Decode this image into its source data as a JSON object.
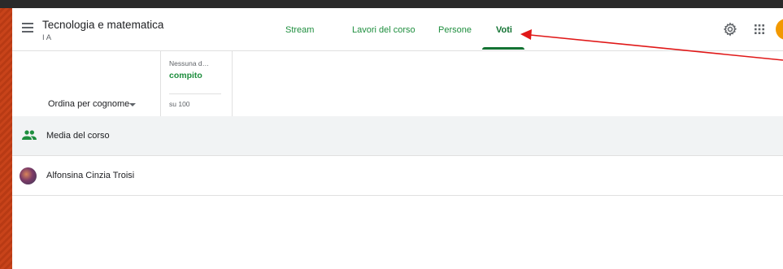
{
  "header": {
    "course_title": "Tecnologia e matematica",
    "course_section": "I A"
  },
  "tabs": [
    {
      "label": "Stream"
    },
    {
      "label": "Lavori del corso"
    },
    {
      "label": "Persone"
    },
    {
      "label": "Voti",
      "active": true
    }
  ],
  "icons": {
    "menu": "menu-icon",
    "settings": "gear-icon",
    "apps": "apps-grid-icon",
    "people": "people-icon"
  },
  "grades": {
    "sort_label": "Ordina per cognome",
    "assignment": {
      "date": "Nessuna d…",
      "title": "compito",
      "points": "su 100"
    },
    "rows": [
      {
        "label": "Media del corso",
        "grade": ""
      },
      {
        "label": "Alfonsina Cinzia Troisi",
        "grade": ""
      }
    ]
  },
  "colors": {
    "accent": "#137333",
    "tab_text": "#1e8e3e",
    "background_stripes": "#c8431a",
    "annotation_arrow": "#e01818",
    "avatar": "#f29900"
  }
}
